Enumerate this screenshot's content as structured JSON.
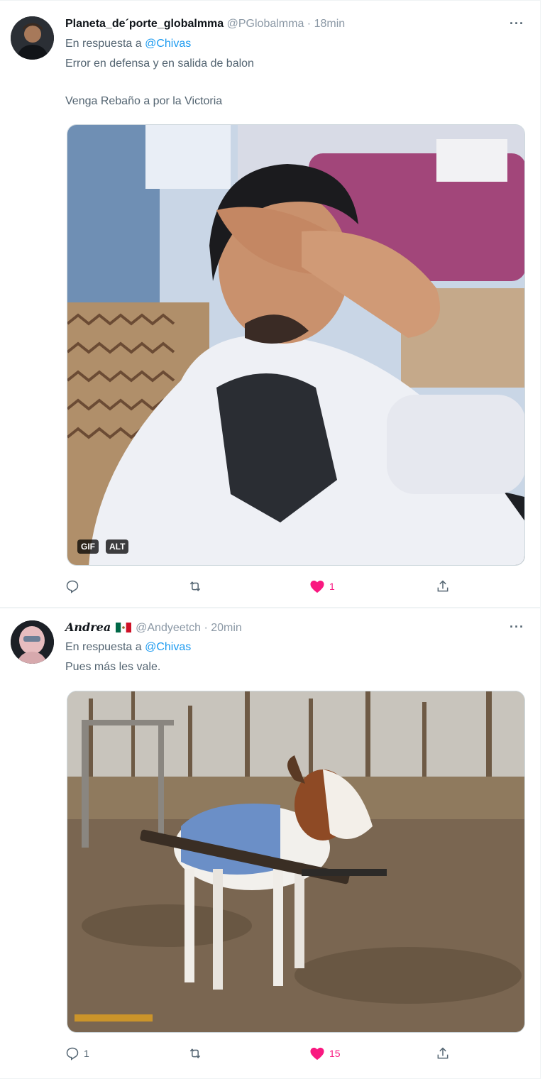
{
  "tweets": [
    {
      "display_name": "Planeta_de´porte_globalmma",
      "handle": "@PGlobalmma",
      "separator": "·",
      "time": "18min",
      "reply_prefix": "En respuesta a",
      "reply_to": "@Chivas",
      "text_line1": "Error en defensa y en salida de balon",
      "text_line2": "Venga Rebaño a por la Victoria",
      "media_badges": [
        "GIF",
        "ALT"
      ],
      "actions": {
        "replies": "",
        "retweets": "",
        "likes": "1"
      }
    },
    {
      "display_name": "Andrea",
      "handle": "@Andyeetch",
      "separator": "·",
      "time": "20min",
      "reply_prefix": "En respuesta a",
      "reply_to": "@Chivas",
      "text_line1": "Pues más les vale.",
      "actions": {
        "replies": "1",
        "retweets": "",
        "likes": "15"
      }
    }
  ],
  "icons": {
    "more": "more-horizontal-icon",
    "reply": "reply-icon",
    "retweet": "retweet-icon",
    "like": "heart-icon",
    "share": "share-icon",
    "flag": "mexico-flag-icon"
  },
  "colors": {
    "link": "#1d9bf0",
    "like": "#f91880",
    "muted": "#536471"
  },
  "more_label": "···"
}
